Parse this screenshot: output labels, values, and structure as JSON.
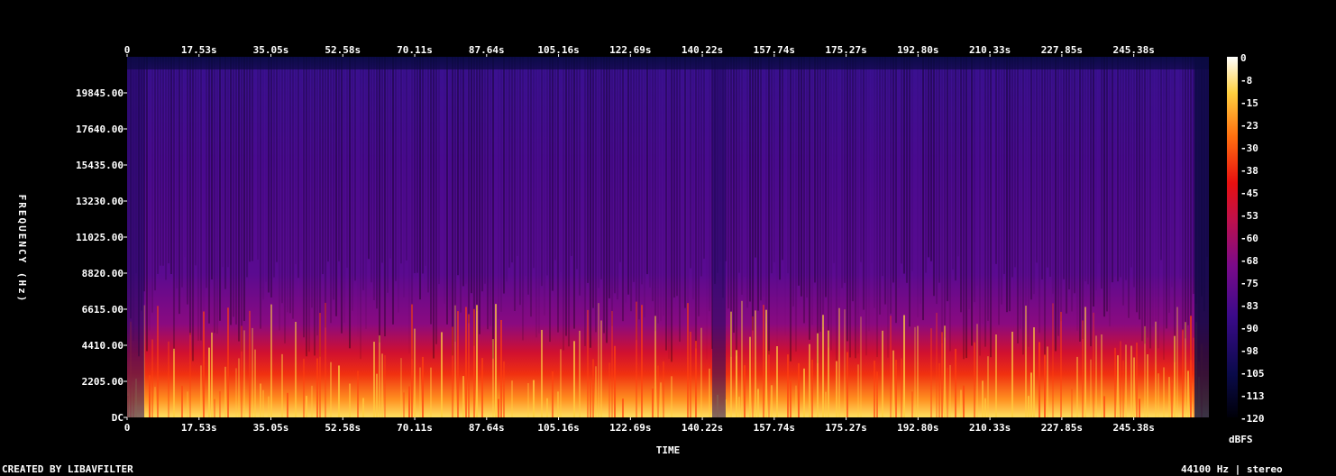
{
  "chart_data": {
    "type": "heatmap",
    "subtype": "spectrogram",
    "xlabel": "TIME",
    "ylabel": "FREQUENCY (Hz)",
    "x_ticks": [
      "0",
      "17.53s",
      "35.05s",
      "52.58s",
      "70.11s",
      "87.64s",
      "105.16s",
      "122.69s",
      "140.22s",
      "157.74s",
      "175.27s",
      "192.80s",
      "210.33s",
      "227.85s",
      "245.38s"
    ],
    "x_range_s": [
      0,
      264
    ],
    "y_ticks": [
      "DC",
      "2205.00",
      "4410.00",
      "6615.00",
      "8820.00",
      "11025.00",
      "13230.00",
      "15435.00",
      "17640.00",
      "19845.00"
    ],
    "y_range_hz": [
      0,
      22050
    ],
    "colorbar": {
      "unit": "dBFS",
      "ticks": [
        "0",
        "-8",
        "-15",
        "-23",
        "-30",
        "-38",
        "-45",
        "-53",
        "-60",
        "-68",
        "-75",
        "-83",
        "-90",
        "-98",
        "-105",
        "-113",
        "-120"
      ],
      "range": [
        -120,
        0
      ]
    },
    "grid": false
  },
  "footer": {
    "credit": "CREATED BY LIBAVFILTER",
    "info": "44100 Hz | stereo"
  }
}
